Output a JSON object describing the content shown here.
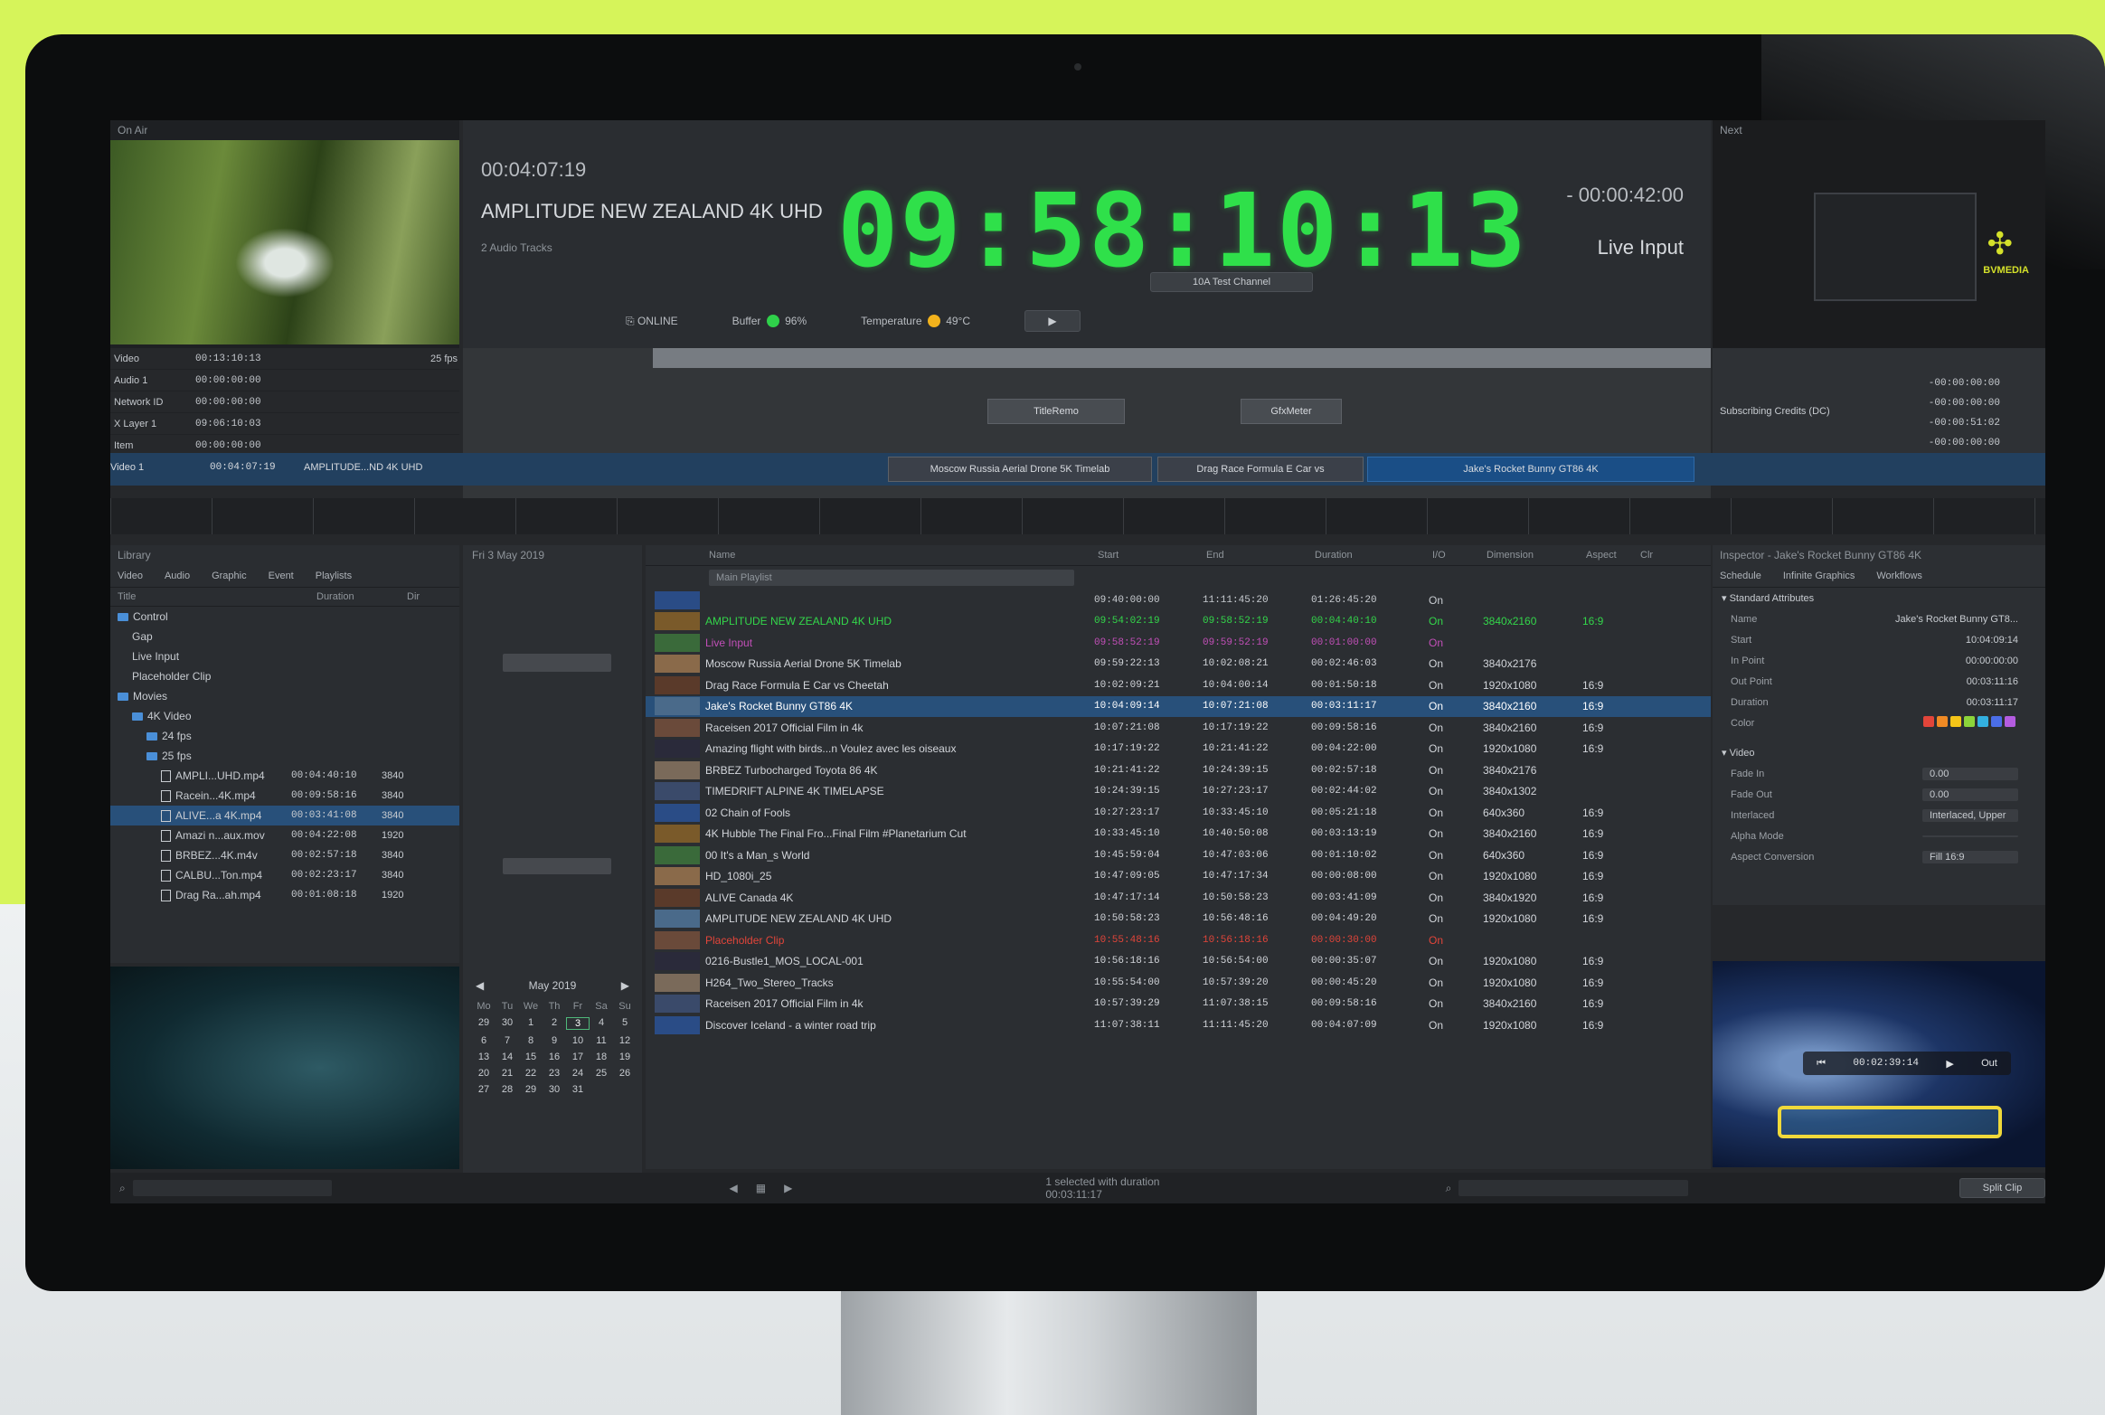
{
  "app": {
    "left_panel_title": "On Air",
    "right_panel_title": "Next",
    "brand": "BVMEDIA"
  },
  "clock": {
    "elapsed": "00:04:07:19",
    "current_title": "AMPLITUDE NEW ZEALAND 4K UHD",
    "audio_tracks": "2 Audio Tracks",
    "time": "09:58:10:13",
    "remaining": "- 00:00:42:00",
    "next_item": "Live Input",
    "channel_button": "10A Test Channel",
    "status_online": "ONLINE",
    "buffer_label": "Buffer",
    "buffer_value": "96%",
    "temperature_label": "Temperature",
    "temperature_value": "49°C"
  },
  "on_air_tracks": [
    {
      "name": "Video",
      "tc": "00:13:10:13",
      "extra": "25 fps"
    },
    {
      "name": "Audio 1",
      "tc": "00:00:00:00",
      "extra": ""
    },
    {
      "name": "Network ID",
      "tc": "00:00:00:00",
      "extra": ""
    },
    {
      "name": "X Layer 1",
      "tc": "09:06:10:03",
      "extra": ""
    },
    {
      "name": "Item",
      "tc": "00:00:00:00",
      "extra": ""
    }
  ],
  "timeline": {
    "current_row_track": "Video 1",
    "current_row_tc": "00:04:07:19",
    "current_row_title": "AMPLITUDE...ND 4K UHD",
    "clip_1": "Moscow Russia Aerial Drone 5K Timelab",
    "clip_2": "Drag Race Formula E Car vs",
    "clip_3": "Jake's Rocket Bunny GT86 4K",
    "marker_1": "TitleRemo",
    "marker_2": "GfxMeter",
    "right_clip": "Subscribing Credits (DC)",
    "right_times": [
      "-00:00:00:00",
      "-00:00:00:00",
      "-00:00:51:02",
      "-00:00:00:00"
    ]
  },
  "library": {
    "title": "Library",
    "tabs": [
      "Video",
      "Audio",
      "Graphic",
      "Event",
      "Playlists"
    ],
    "columns": [
      "Title",
      "Duration",
      "Dir"
    ],
    "tree": [
      {
        "label": "Control",
        "type": "folder",
        "indent": 0
      },
      {
        "label": "Gap",
        "type": "item",
        "indent": 1
      },
      {
        "label": "Live Input",
        "type": "item",
        "indent": 1
      },
      {
        "label": "Placeholder Clip",
        "type": "item",
        "indent": 1
      },
      {
        "label": "Movies",
        "type": "folder",
        "indent": 0
      },
      {
        "label": "4K Video",
        "type": "folder",
        "indent": 1
      },
      {
        "label": "24 fps",
        "type": "folder",
        "indent": 2
      },
      {
        "label": "25 fps",
        "type": "folder",
        "indent": 2
      },
      {
        "label": "AMPLI...UHD.mp4",
        "dur": "00:04:40:10",
        "res": "3840",
        "type": "file",
        "indent": 3
      },
      {
        "label": "Racein...4K.mp4",
        "dur": "00:09:58:16",
        "res": "3840",
        "type": "file",
        "indent": 3
      },
      {
        "label": "ALIVE...a 4K.mp4",
        "dur": "00:03:41:08",
        "res": "3840",
        "type": "file",
        "indent": 3,
        "selected": true
      },
      {
        "label": "Amazi n...aux.mov",
        "dur": "00:04:22:08",
        "res": "1920",
        "type": "file",
        "indent": 3
      },
      {
        "label": "BRBEZ...4K.m4v",
        "dur": "00:02:57:18",
        "res": "3840",
        "type": "file",
        "indent": 3
      },
      {
        "label": "CALBU...Ton.mp4",
        "dur": "00:02:23:17",
        "res": "3840",
        "type": "file",
        "indent": 3
      },
      {
        "label": "Drag Ra...ah.mp4",
        "dur": "00:01:08:18",
        "res": "1920",
        "type": "file",
        "indent": 3
      }
    ]
  },
  "calendar": {
    "date_header": "Fri 3 May 2019",
    "month": "May 2019",
    "weekdays": [
      "Mo",
      "Tu",
      "We",
      "Th",
      "Fr",
      "Sa",
      "Su"
    ],
    "days": [
      "29",
      "30",
      "1",
      "2",
      "3",
      "4",
      "5",
      "6",
      "7",
      "8",
      "9",
      "10",
      "11",
      "12",
      "13",
      "14",
      "15",
      "16",
      "17",
      "18",
      "19",
      "20",
      "21",
      "22",
      "23",
      "24",
      "25",
      "26",
      "27",
      "28",
      "29",
      "30",
      "31",
      "",
      ""
    ],
    "selected_day": "3"
  },
  "playlist": {
    "columns": [
      "Name",
      "Start",
      "End",
      "Duration",
      "I/O",
      "Dimension",
      "Aspect",
      "Clr"
    ],
    "group": "Main Playlist",
    "rows": [
      {
        "name": "",
        "start": "09:40:00:00",
        "end": "11:11:45:20",
        "dur": "01:26:45:20",
        "io": "On",
        "dim": "",
        "asp": "",
        "color": "#c8ccd1"
      },
      {
        "name": "AMPLITUDE NEW ZEALAND 4K UHD",
        "start": "09:54:02:19",
        "end": "09:58:52:19",
        "dur": "00:04:40:10",
        "io": "On",
        "dim": "3840x2160",
        "asp": "16:9",
        "color": "#33d64a"
      },
      {
        "name": "Live Input",
        "start": "09:58:52:19",
        "end": "09:59:52:19",
        "dur": "00:01:00:00",
        "io": "On",
        "dim": "",
        "asp": "",
        "color": "#c24fb8"
      },
      {
        "name": "Moscow Russia Aerial Drone 5K Timelab",
        "start": "09:59:22:13",
        "end": "10:02:08:21",
        "dur": "00:02:46:03",
        "io": "On",
        "dim": "3840x2176",
        "asp": "",
        "color": "#d2d5da"
      },
      {
        "name": "Drag Race Formula E Car vs Cheetah",
        "start": "10:02:09:21",
        "end": "10:04:00:14",
        "dur": "00:01:50:18",
        "io": "On",
        "dim": "1920x1080",
        "asp": "16:9",
        "color": "#d2d5da"
      },
      {
        "name": "Jake's Rocket Bunny GT86 4K",
        "start": "10:04:09:14",
        "end": "10:07:21:08",
        "dur": "00:03:11:17",
        "io": "On",
        "dim": "3840x2160",
        "asp": "16:9",
        "color": "#ffffff",
        "selected": true
      },
      {
        "name": "Raceisen 2017 Official Film in 4k",
        "start": "10:07:21:08",
        "end": "10:17:19:22",
        "dur": "00:09:58:16",
        "io": "On",
        "dim": "3840x2160",
        "asp": "16:9",
        "color": "#d2d5da"
      },
      {
        "name": "Amazing flight with birds...n Voulez avec les oiseaux",
        "start": "10:17:19:22",
        "end": "10:21:41:22",
        "dur": "00:04:22:00",
        "io": "On",
        "dim": "1920x1080",
        "asp": "16:9",
        "color": "#d2d5da"
      },
      {
        "name": "BRBEZ Turbocharged Toyota 86 4K",
        "start": "10:21:41:22",
        "end": "10:24:39:15",
        "dur": "00:02:57:18",
        "io": "On",
        "dim": "3840x2176",
        "asp": "",
        "color": "#d2d5da"
      },
      {
        "name": "TIMEDRIFT ALPINE 4K TIMELAPSE",
        "start": "10:24:39:15",
        "end": "10:27:23:17",
        "dur": "00:02:44:02",
        "io": "On",
        "dim": "3840x1302",
        "asp": "",
        "color": "#d2d5da"
      },
      {
        "name": "02 Chain of Fools",
        "start": "10:27:23:17",
        "end": "10:33:45:10",
        "dur": "00:05:21:18",
        "io": "On",
        "dim": "640x360",
        "asp": "16:9",
        "color": "#d2d5da"
      },
      {
        "name": "4K Hubble The Final Fro...Final Film #Planetarium Cut",
        "start": "10:33:45:10",
        "end": "10:40:50:08",
        "dur": "00:03:13:19",
        "io": "On",
        "dim": "3840x2160",
        "asp": "16:9",
        "color": "#d2d5da"
      },
      {
        "name": "00 It's a Man_s World",
        "start": "10:45:59:04",
        "end": "10:47:03:06",
        "dur": "00:01:10:02",
        "io": "On",
        "dim": "640x360",
        "asp": "16:9",
        "color": "#d2d5da"
      },
      {
        "name": "HD_1080i_25",
        "start": "10:47:09:05",
        "end": "10:47:17:34",
        "dur": "00:00:08:00",
        "io": "On",
        "dim": "1920x1080",
        "asp": "16:9",
        "color": "#d2d5da"
      },
      {
        "name": "ALIVE Canada 4K",
        "start": "10:47:17:14",
        "end": "10:50:58:23",
        "dur": "00:03:41:09",
        "io": "On",
        "dim": "3840x1920",
        "asp": "16:9",
        "color": "#d2d5da"
      },
      {
        "name": "AMPLITUDE NEW ZEALAND 4K UHD",
        "start": "10:50:58:23",
        "end": "10:56:48:16",
        "dur": "00:04:49:20",
        "io": "On",
        "dim": "1920x1080",
        "asp": "16:9",
        "color": "#d2d5da"
      },
      {
        "name": "Placeholder Clip",
        "start": "10:55:48:16",
        "end": "10:56:18:16",
        "dur": "00:00:30:00",
        "io": "On",
        "dim": "",
        "asp": "",
        "color": "#e2453a"
      },
      {
        "name": "0216-Bustle1_MOS_LOCAL-001",
        "start": "10:56:18:16",
        "end": "10:56:54:00",
        "dur": "00:00:35:07",
        "io": "On",
        "dim": "1920x1080",
        "asp": "16:9",
        "color": "#d2d5da"
      },
      {
        "name": "H264_Two_Stereo_Tracks",
        "start": "10:55:54:00",
        "end": "10:57:39:20",
        "dur": "00:00:45:20",
        "io": "On",
        "dim": "1920x1080",
        "asp": "16:9",
        "color": "#d2d5da"
      },
      {
        "name": "Raceisen 2017 Official Film in 4k",
        "start": "10:57:39:29",
        "end": "11:07:38:15",
        "dur": "00:09:58:16",
        "io": "On",
        "dim": "3840x2160",
        "asp": "16:9",
        "color": "#d2d5da"
      },
      {
        "name": "Discover Iceland - a winter road trip",
        "start": "11:07:38:11",
        "end": "11:11:45:20",
        "dur": "00:04:07:09",
        "io": "On",
        "dim": "1920x1080",
        "asp": "16:9",
        "color": "#d2d5da"
      }
    ]
  },
  "inspector": {
    "title": "Inspector - Jake's Rocket Bunny GT86 4K",
    "tabs": [
      "Schedule",
      "Infinite Graphics",
      "Workflows"
    ],
    "section_1": "Standard Attributes",
    "fields": [
      {
        "label": "Name",
        "value": "Jake's Rocket Bunny GT8..."
      },
      {
        "label": "Start",
        "value": "10:04:09:14"
      },
      {
        "label": "In Point",
        "value": "00:00:00:00"
      },
      {
        "label": "Out Point",
        "value": "00:03:11:16"
      },
      {
        "label": "Duration",
        "value": "00:03:11:17"
      },
      {
        "label": "Color",
        "value": ""
      }
    ],
    "colors": [
      "#e2453a",
      "#f08a24",
      "#f5c518",
      "#8cd43a",
      "#33b0e0",
      "#4b6ee8",
      "#b45ce0"
    ],
    "section_2": "Video",
    "video_fields": [
      {
        "label": "Fade In",
        "value": "0.00"
      },
      {
        "label": "Fade Out",
        "value": "0.00"
      },
      {
        "label": "Interlaced",
        "value": "Interlaced, Upper"
      },
      {
        "label": "Alpha Mode",
        "value": ""
      },
      {
        "label": "Aspect Conversion",
        "value": "Fill 16:9"
      }
    ]
  },
  "preview_player": {
    "timecode": "00:02:39:14",
    "out_label": "Out"
  },
  "bottombar": {
    "status": "1 selected with duration 00:03:11:17",
    "split_clip": "Split Clip"
  }
}
